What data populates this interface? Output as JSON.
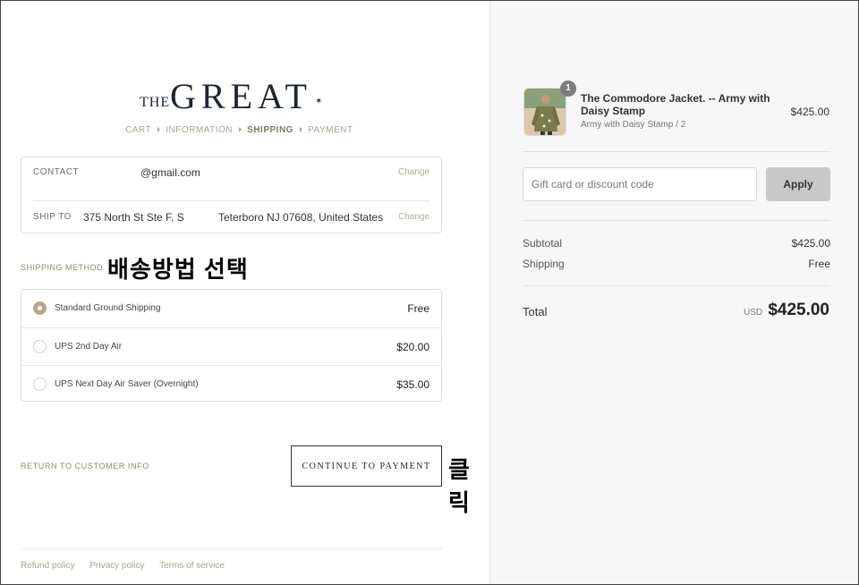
{
  "brand": {
    "prefix": "THE",
    "name": "GREAT",
    "mark": "✶"
  },
  "breadcrumb": [
    {
      "label": "CART",
      "active": false
    },
    {
      "label": "INFORMATION",
      "active": false
    },
    {
      "label": "SHIPPING",
      "active": true
    },
    {
      "label": "PAYMENT",
      "active": false
    }
  ],
  "info": {
    "contact_label": "CONTACT",
    "contact_value": "@gmail.com",
    "ship_to_label": "SHIP TO",
    "ship_to_street": "375 North St Ste F, S",
    "ship_to_city": "Teterboro NJ 07608, United States",
    "change_label": "Change"
  },
  "shipping": {
    "section_label": "SHIPPING METHOD",
    "annotation": "배송방법 선택",
    "methods": [
      {
        "name": "Standard Ground Shipping",
        "price": "Free",
        "selected": true
      },
      {
        "name": "UPS 2nd Day Air",
        "price": "$20.00",
        "selected": false
      },
      {
        "name": "UPS Next Day Air Saver (Overnight)",
        "price": "$35.00",
        "selected": false
      }
    ]
  },
  "actions": {
    "return_label": "RETURN TO CUSTOMER INFO",
    "continue_label": "CONTINUE TO PAYMENT",
    "annotation": "클릭"
  },
  "footer": {
    "links": [
      "Refund policy",
      "Privacy policy",
      "Terms of service"
    ]
  },
  "summary": {
    "product": {
      "quantity": "1",
      "title": "The Commodore Jacket. -- Army with Daisy Stamp",
      "variant": "Army with Daisy Stamp / 2",
      "price": "$425.00",
      "thumb_icon": "jacket-photo"
    },
    "discount": {
      "placeholder": "Gift card or discount code",
      "apply_label": "Apply"
    },
    "subtotal_label": "Subtotal",
    "subtotal_value": "$425.00",
    "shipping_label": "Shipping",
    "shipping_value": "Free",
    "total_label": "Total",
    "currency": "USD",
    "total_value": "$425.00"
  },
  "colors": {
    "accent": "#b8a58c",
    "crumb": "#a9a58f",
    "brand": "#1d2433"
  }
}
